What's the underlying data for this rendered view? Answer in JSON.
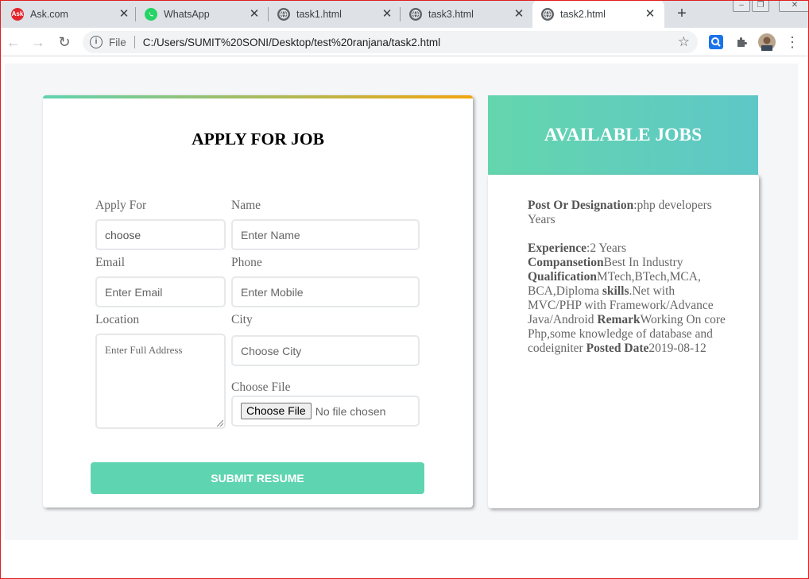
{
  "browser": {
    "tabs": [
      {
        "title": "Ask.com",
        "icon": "ask-icon"
      },
      {
        "title": "WhatsApp",
        "icon": "whatsapp-icon"
      },
      {
        "title": "task1.html",
        "icon": "globe-icon"
      },
      {
        "title": "task3.html",
        "icon": "globe-icon"
      },
      {
        "title": "task2.html",
        "icon": "globe-icon",
        "active": true
      }
    ],
    "address": {
      "chip": "File",
      "url": "C:/Users/SUMIT%20SONI/Desktop/test%20ranjana/task2.html"
    }
  },
  "apply_form": {
    "title": "APPLY FOR JOB",
    "apply_for": {
      "label": "Apply For",
      "value": "choose"
    },
    "name": {
      "label": "Name",
      "placeholder": "Enter Name"
    },
    "email": {
      "label": "Email",
      "placeholder": "Enter Email"
    },
    "phone": {
      "label": "Phone",
      "placeholder": "Enter Mobile"
    },
    "location": {
      "label": "Location",
      "placeholder": "Enter Full Address"
    },
    "city": {
      "label": "City",
      "placeholder": "Choose City"
    },
    "file": {
      "label": "Choose File",
      "button": "Choose File",
      "status": "No file chosen"
    },
    "submit": "SUBMIT RESUME"
  },
  "jobs": {
    "header": "AVAILABLE JOBS",
    "post_label": "Post Or Designation",
    "post_value": ":php developers Years",
    "experience_label": "Experience",
    "experience_value": ":2 Years",
    "compansetion_label": "Compansetion",
    "compansetion_value": "Best In Industry",
    "qualification_label": "Qualification",
    "qualification_value": "MTech,BTech,MCA, BCA,Diploma ",
    "skills_label": "skills",
    "skills_value": ".Net with MVC/PHP with Framework/Advance Java/Android ",
    "remark_label": "Remark",
    "remark_value": "Working On core Php,some knowledge of database and codeigniter ",
    "posted_label": "Posted Date",
    "posted_value": "2019-08-12"
  },
  "colors": {
    "accent_green": "#5fd4b0",
    "accent_orange": "#f2a50f",
    "teal": "#5ec7c7"
  }
}
